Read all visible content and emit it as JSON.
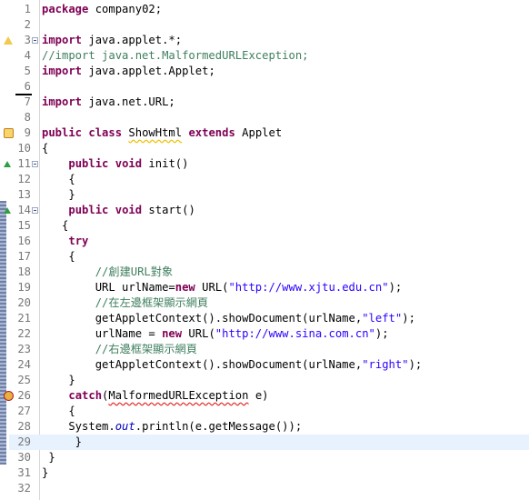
{
  "editor": {
    "current_line": 29,
    "lines": [
      {
        "n": "1",
        "tokens": [
          {
            "t": "package",
            "c": "kw"
          },
          {
            "t": " company02;"
          }
        ]
      },
      {
        "n": "2",
        "tokens": []
      },
      {
        "n": "3",
        "tokens": [
          {
            "t": "import",
            "c": "kw"
          },
          {
            "t": " java.applet.*;"
          }
        ]
      },
      {
        "n": "4",
        "tokens": [
          {
            "t": "//import java.net.MalformedURLException;",
            "c": "cm"
          }
        ]
      },
      {
        "n": "5",
        "tokens": [
          {
            "t": "import",
            "c": "kw"
          },
          {
            "t": " java.applet.Applet;"
          }
        ]
      },
      {
        "n": "6",
        "tokens": []
      },
      {
        "n": "7",
        "tokens": [
          {
            "t": "import",
            "c": "kw"
          },
          {
            "t": " java.net.URL;"
          }
        ]
      },
      {
        "n": "8",
        "tokens": []
      },
      {
        "n": "9",
        "tokens": [
          {
            "t": "public",
            "c": "kw"
          },
          {
            "t": " "
          },
          {
            "t": "class",
            "c": "kw"
          },
          {
            "t": " "
          },
          {
            "t": "ShowHtml",
            "c": "warn"
          },
          {
            "t": " "
          },
          {
            "t": "extends",
            "c": "kw"
          },
          {
            "t": " Applet"
          }
        ]
      },
      {
        "n": "10",
        "tokens": [
          {
            "t": "{"
          }
        ]
      },
      {
        "n": "11",
        "tokens": [
          {
            "t": "    "
          },
          {
            "t": "public",
            "c": "kw"
          },
          {
            "t": " "
          },
          {
            "t": "void",
            "c": "kw"
          },
          {
            "t": " init()"
          }
        ]
      },
      {
        "n": "12",
        "tokens": [
          {
            "t": "    {"
          }
        ]
      },
      {
        "n": "13",
        "tokens": [
          {
            "t": "    }"
          }
        ]
      },
      {
        "n": "14",
        "tokens": [
          {
            "t": "    "
          },
          {
            "t": "public",
            "c": "kw"
          },
          {
            "t": " "
          },
          {
            "t": "void",
            "c": "kw"
          },
          {
            "t": " start()"
          }
        ]
      },
      {
        "n": "15",
        "tokens": [
          {
            "t": "   {"
          }
        ]
      },
      {
        "n": "16",
        "tokens": [
          {
            "t": "    "
          },
          {
            "t": "try",
            "c": "kw"
          }
        ]
      },
      {
        "n": "17",
        "tokens": [
          {
            "t": "    {"
          }
        ]
      },
      {
        "n": "18",
        "tokens": [
          {
            "t": "        "
          },
          {
            "t": "//創建URL對象",
            "c": "cm"
          }
        ]
      },
      {
        "n": "19",
        "tokens": [
          {
            "t": "        URL urlName="
          },
          {
            "t": "new",
            "c": "kw"
          },
          {
            "t": " URL("
          },
          {
            "t": "\"http://www.xjtu.edu.cn\"",
            "c": "str"
          },
          {
            "t": ");"
          }
        ]
      },
      {
        "n": "20",
        "tokens": [
          {
            "t": "        "
          },
          {
            "t": "//在左邊框架顯示網頁",
            "c": "cm"
          }
        ]
      },
      {
        "n": "21",
        "tokens": [
          {
            "t": "        getAppletContext().showDocument(urlName,"
          },
          {
            "t": "\"left\"",
            "c": "str"
          },
          {
            "t": ");"
          }
        ]
      },
      {
        "n": "22",
        "tokens": [
          {
            "t": "        urlName = "
          },
          {
            "t": "new",
            "c": "kw"
          },
          {
            "t": " URL("
          },
          {
            "t": "\"http://www.sina.com.cn\"",
            "c": "str"
          },
          {
            "t": ");"
          }
        ]
      },
      {
        "n": "23",
        "tokens": [
          {
            "t": "        "
          },
          {
            "t": "//右邊框架顯示網頁",
            "c": "cm"
          }
        ]
      },
      {
        "n": "24",
        "tokens": [
          {
            "t": "        getAppletContext().showDocument(urlName,"
          },
          {
            "t": "\"right\"",
            "c": "str"
          },
          {
            "t": ");"
          }
        ]
      },
      {
        "n": "25",
        "tokens": [
          {
            "t": "    }"
          }
        ]
      },
      {
        "n": "26",
        "tokens": [
          {
            "t": "    "
          },
          {
            "t": "catch",
            "c": "kw"
          },
          {
            "t": "("
          },
          {
            "t": "MalformedURLException",
            "c": "err"
          },
          {
            "t": " e)"
          }
        ]
      },
      {
        "n": "27",
        "tokens": [
          {
            "t": "    {"
          }
        ]
      },
      {
        "n": "28",
        "tokens": [
          {
            "t": "    System."
          },
          {
            "t": "out",
            "c": "it"
          },
          {
            "t": ".println(e.getMessage());"
          }
        ]
      },
      {
        "n": "29",
        "tokens": [
          {
            "t": "     }"
          }
        ]
      },
      {
        "n": "30",
        "tokens": [
          {
            "t": " }"
          }
        ]
      },
      {
        "n": "31",
        "tokens": [
          {
            "t": "}"
          }
        ]
      },
      {
        "n": "32",
        "tokens": []
      }
    ],
    "folds": [
      "3",
      "11",
      "14"
    ],
    "gutter_icons": [
      {
        "line": "3",
        "icon": "warning-icon"
      },
      {
        "line": "6",
        "icon": "caret-marker-icon"
      },
      {
        "line": "9",
        "icon": "quickfix-icon"
      },
      {
        "line": "11",
        "icon": "override-up-icon"
      },
      {
        "line": "14",
        "icon": "override-up-icon"
      },
      {
        "line": "26",
        "icon": "error-icon"
      }
    ],
    "colors": {
      "keyword": "#7f0055",
      "comment": "#3f7f5f",
      "string": "#2a00ff",
      "field": "#0000c0",
      "current_line": "#e8f2fe"
    }
  }
}
